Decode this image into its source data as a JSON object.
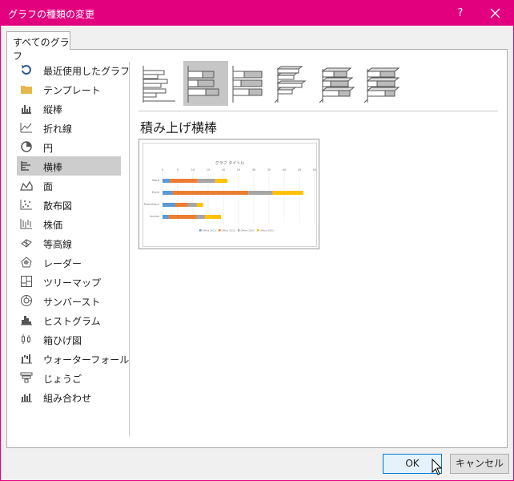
{
  "window": {
    "title": "グラフの種類の変更",
    "help": "?"
  },
  "tab": {
    "label": "すべてのグラフ"
  },
  "sidebar": {
    "items": [
      {
        "label": "最近使用したグラフ",
        "icon": "recent-icon"
      },
      {
        "label": "テンプレート",
        "icon": "folder-icon"
      },
      {
        "label": "縦棒",
        "icon": "column-chart-icon"
      },
      {
        "label": "折れ線",
        "icon": "line-chart-icon"
      },
      {
        "label": "円",
        "icon": "pie-chart-icon"
      },
      {
        "label": "横棒",
        "icon": "bar-chart-icon",
        "selected": true
      },
      {
        "label": "面",
        "icon": "area-chart-icon"
      },
      {
        "label": "散布図",
        "icon": "scatter-chart-icon"
      },
      {
        "label": "株価",
        "icon": "stock-chart-icon"
      },
      {
        "label": "等高線",
        "icon": "surface-chart-icon"
      },
      {
        "label": "レーダー",
        "icon": "radar-chart-icon"
      },
      {
        "label": "ツリーマップ",
        "icon": "treemap-chart-icon"
      },
      {
        "label": "サンバースト",
        "icon": "sunburst-chart-icon"
      },
      {
        "label": "ヒストグラム",
        "icon": "histogram-chart-icon"
      },
      {
        "label": "箱ひげ図",
        "icon": "box-whisker-chart-icon"
      },
      {
        "label": "ウォーターフォール",
        "icon": "waterfall-chart-icon"
      },
      {
        "label": "じょうご",
        "icon": "funnel-chart-icon"
      },
      {
        "label": "組み合わせ",
        "icon": "combo-chart-icon"
      }
    ]
  },
  "subtypes": [
    {
      "icon": "clustered-bar-icon"
    },
    {
      "icon": "stacked-bar-icon",
      "selected": true
    },
    {
      "icon": "100-stacked-bar-icon"
    },
    {
      "icon": "3d-clustered-bar-icon"
    },
    {
      "icon": "3d-stacked-bar-icon"
    },
    {
      "icon": "3d-100-stacked-bar-icon"
    }
  ],
  "subtype_title": "積み上げ横棒",
  "preview": {
    "title": "グラフ タイトル",
    "categories": [
      "Word",
      "Excel",
      "PowerPoint",
      "Access"
    ],
    "axis_ticks": [
      "0",
      "5",
      "10",
      "15",
      "20",
      "25",
      "30",
      "35",
      "40",
      "45",
      "50"
    ],
    "series": [
      {
        "name": "Office 2013",
        "color": "#5b9bd5",
        "values": [
          2.4,
          3.3,
          4.2,
          2.0
        ]
      },
      {
        "name": "Office 2010",
        "color": "#ed7d31",
        "values": [
          9.1,
          24.9,
          4.1,
          9.2
        ]
      },
      {
        "name": "Office 2007",
        "color": "#a5a5a5",
        "values": [
          5.8,
          8.0,
          3.0,
          2.8
        ]
      },
      {
        "name": "Office 2003",
        "color": "#ffc000",
        "values": [
          4.0,
          10.0,
          2.0,
          5.2
        ]
      }
    ],
    "xlim": [
      0,
      50
    ]
  },
  "buttons": {
    "ok": "OK",
    "cancel": "キャンセル"
  },
  "colors": {
    "titlebar": "#e3007f",
    "selected_bg": "#cdcdcd"
  }
}
